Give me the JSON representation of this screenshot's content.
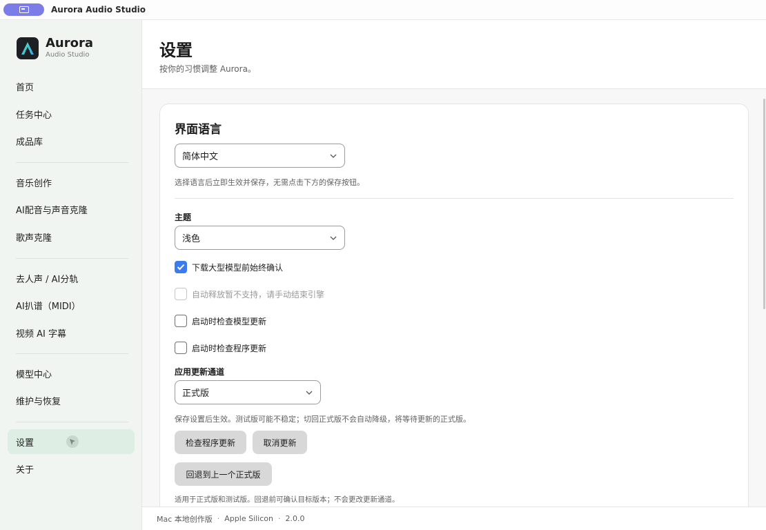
{
  "titlebar": {
    "title": "Aurora Audio Studio",
    "icon": "window-pill-icon",
    "accent": "#7b7ce8"
  },
  "sidebar": {
    "brand_name": "Aurora",
    "brand_sub": "Audio Studio",
    "logo_icon": "aurora-logo-icon",
    "items": [
      {
        "label": "首页"
      },
      {
        "label": "任务中心"
      },
      {
        "label": "成品库"
      },
      {
        "label": "音乐创作"
      },
      {
        "label": "AI配音与声音克隆"
      },
      {
        "label": "歌声克隆"
      },
      {
        "label": "去人声 / AI分轨"
      },
      {
        "label": "AI扒谱（MIDI）"
      },
      {
        "label": "视频 AI 字幕"
      },
      {
        "label": "模型中心"
      },
      {
        "label": "维护与恢复"
      },
      {
        "label": "设置",
        "active": true
      },
      {
        "label": "关于"
      }
    ],
    "active_color": "#dfeee4"
  },
  "header": {
    "title": "设置",
    "subtitle": "按你的习惯调整 Aurora。"
  },
  "settings": {
    "language": {
      "title": "界面语言",
      "value": "简体中文",
      "hint": "选择语言后立即生效并保存，无需点击下方的保存按钮。"
    },
    "theme": {
      "label": "主题",
      "value": "浅色"
    },
    "checkboxes": [
      {
        "label": "下载大型模型前始终确认",
        "checked": true,
        "disabled": false
      },
      {
        "label": "自动释放暂不支持，请手动结束引擎",
        "checked": false,
        "disabled": true
      },
      {
        "label": "启动时检查模型更新",
        "checked": false,
        "disabled": false
      },
      {
        "label": "启动时检查程序更新",
        "checked": false,
        "disabled": false
      }
    ],
    "channel": {
      "label": "应用更新通道",
      "value": "正式版",
      "hint": "保存设置后生效。测试版可能不稳定；切回正式版不会自动降级，将等待更新的正式版。"
    },
    "buttons": {
      "check_update": "检查程序更新",
      "cancel_update": "取消更新",
      "rollback": "回退到上一个正式版"
    },
    "rollback_hint": "适用于正式版和测试版。回退前可确认目标版本；不会更改更新通道。",
    "check_color": "#3b7bf0"
  },
  "footer": {
    "edition": "Mac 本地创作版",
    "arch": "Apple Silicon",
    "version": "2.0.0",
    "separator": "·"
  }
}
